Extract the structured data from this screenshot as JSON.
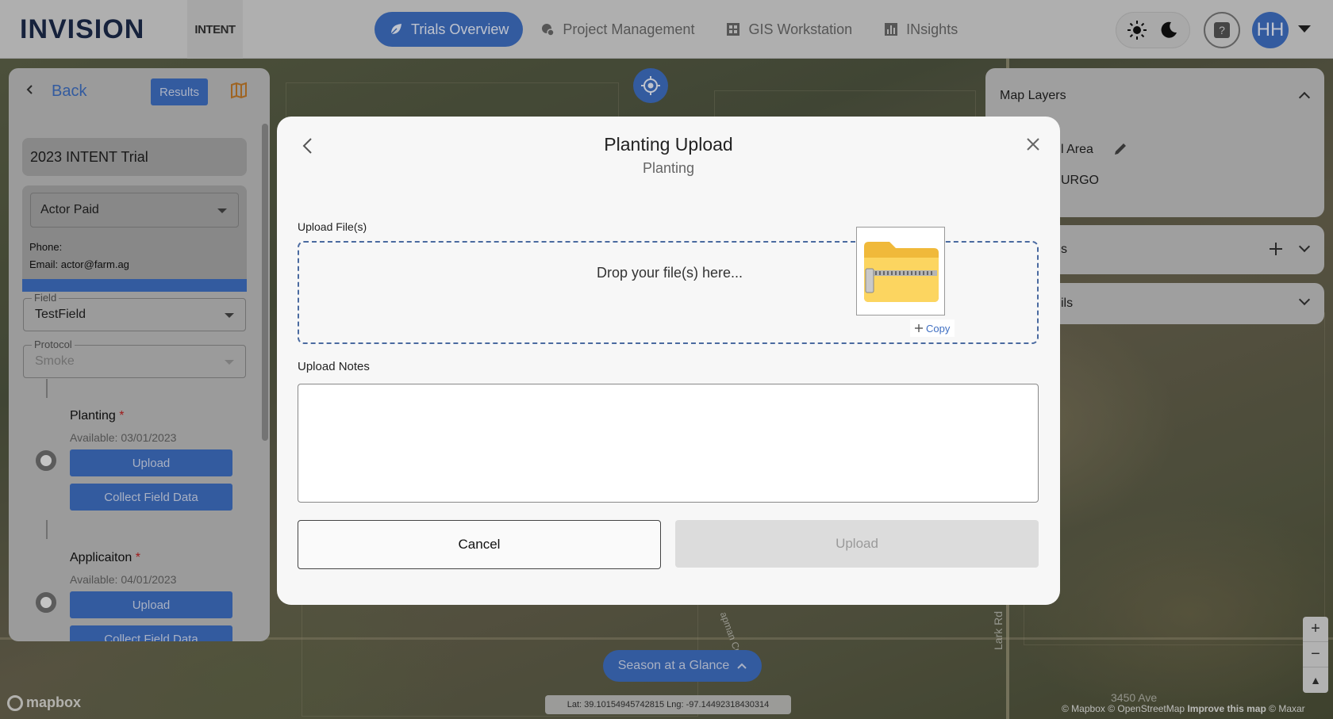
{
  "header": {
    "logo_text": "INVISION",
    "secondary_logo_text": "INTENT",
    "nav": [
      {
        "label": "Trials Overview",
        "icon": "leaf-icon",
        "active": true
      },
      {
        "label": "Project Management",
        "icon": "folder-gear-icon",
        "active": false
      },
      {
        "label": "GIS Workstation",
        "icon": "grid-icon",
        "active": false
      },
      {
        "label": "INsights",
        "icon": "chart-icon",
        "active": false
      }
    ],
    "help_label": "?",
    "avatar_initials": "HH"
  },
  "left_panel": {
    "back_label": "Back",
    "results_label": "Results",
    "trial_name": "2023 INTENT Trial",
    "actor": {
      "selected": "Actor Paid",
      "phone_label": "Phone:",
      "email_label": "Email: actor@farm.ag"
    },
    "field": {
      "legend": "Field",
      "value": "TestField"
    },
    "protocol": {
      "legend": "Protocol",
      "value": "Smoke"
    },
    "steps": [
      {
        "title": "Planting",
        "required_mark": "*",
        "available": "Available: 03/01/2023",
        "upload_label": "Upload",
        "collect_label": "Collect Field Data"
      },
      {
        "title": "Applicaiton",
        "required_mark": "*",
        "available": "Available: 04/01/2023",
        "upload_label": "Upload",
        "collect_label": "Collect Field Data"
      }
    ]
  },
  "right_panel": {
    "map_layers_title": "Map Layers",
    "layer_1": "l Area",
    "layer_2": "URGO",
    "section_2_label": "s",
    "section_3_label": "ils"
  },
  "map": {
    "season_label": "Season at a Glance",
    "latlng": "Lat: 39.10154945742815 Lng: -97.14492318430314",
    "mapbox_label": "mapbox",
    "attribution_1": "© Mapbox © OpenStreetMap",
    "attribution_2": "Improve this map",
    "attribution_3": "© Maxar",
    "road_label_1": "Lark Rd",
    "road_label_2": "3450 Ave",
    "creek_label": "apman Creek",
    "zoom_in": "+",
    "zoom_out": "−",
    "compass": "▲"
  },
  "modal": {
    "title": "Planting Upload",
    "subtitle": "Planting",
    "upload_files_label": "Upload File(s)",
    "drop_text": "Drop your file(s) here...",
    "copy_label": "Copy",
    "notes_label": "Upload Notes",
    "notes_value": "",
    "cancel_label": "Cancel",
    "upload_label": "Upload"
  }
}
